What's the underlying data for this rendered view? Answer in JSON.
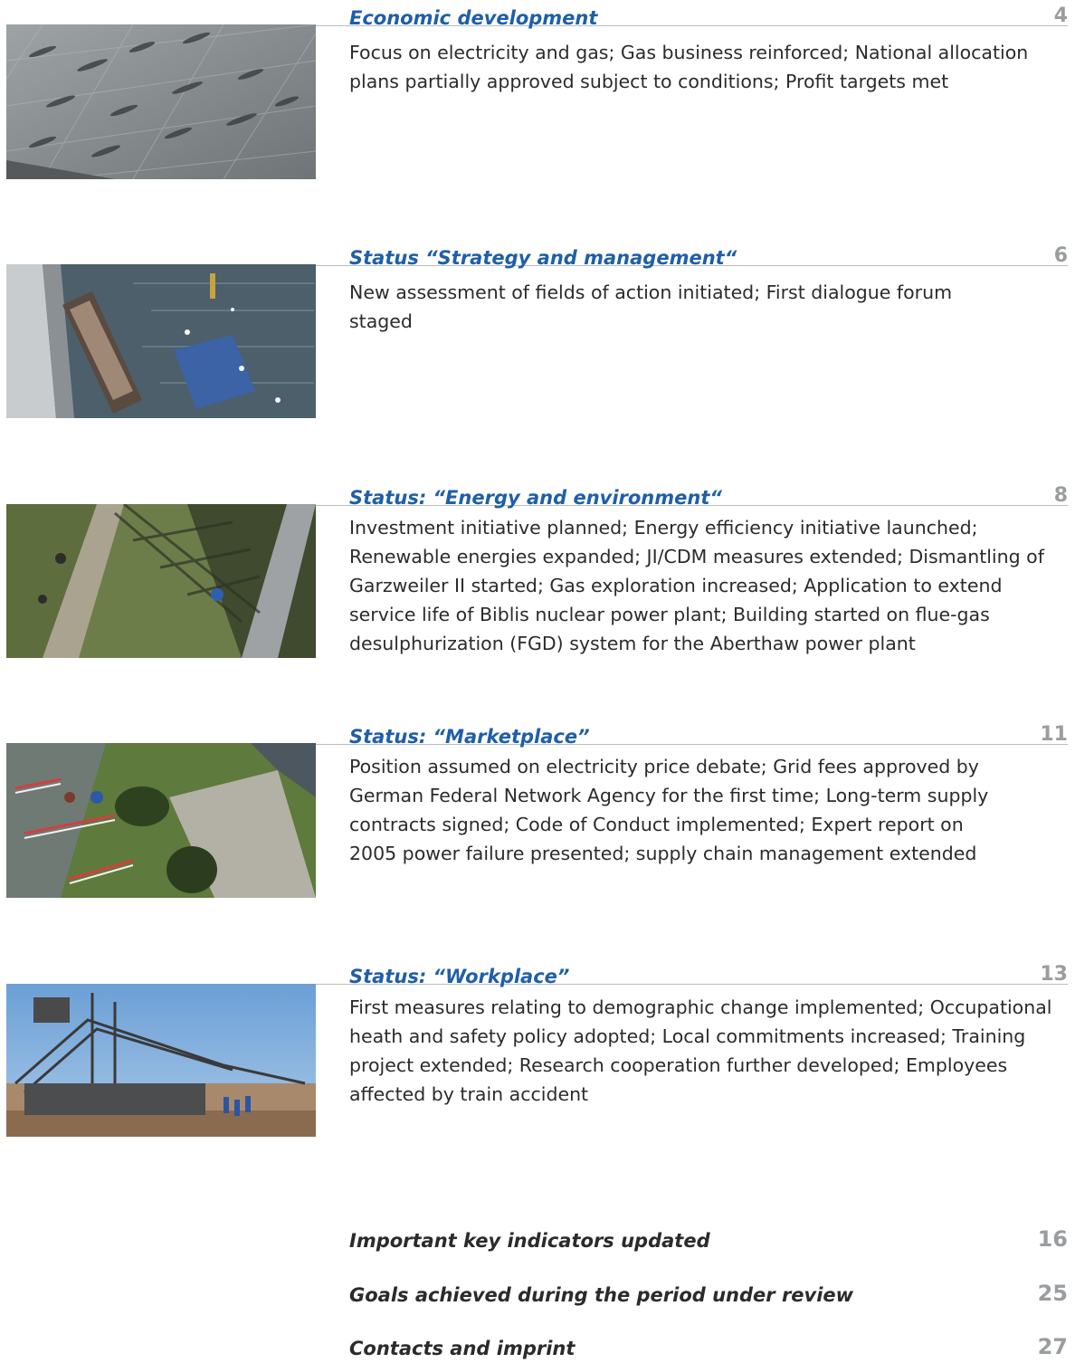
{
  "sections": [
    {
      "title": "Economic development",
      "page": "4",
      "description": "Focus on electricity and gas; Gas business reinforced; National allocation plans partially approved subject to conditions; Profit targets met",
      "photo": "aerial view of pedestrians casting long shadows on paved plaza"
    },
    {
      "title": "Status “Strategy and management“",
      "page": "6",
      "description": "New assessment of fields of action initiated; First dialogue forum staged",
      "photo": "aerial view of harbour with boat and floating container, gulls over water"
    },
    {
      "title": "Status: “Energy and environment“",
      "page": "8",
      "description": "Investment initiative planned; Energy efficiency initiative launched; Renewable energies expanded; JI/CDM measures extended; Dismantling of Garzweiler II started; Gas exploration increased; Application to extend service life of Biblis nuclear power plant; Building started on flue-gas desulphurization (FGD) system for the Aberthaw power plant",
      "photo": "aerial view of cyclists on path beside a lattice transmission tower"
    },
    {
      "title": "Status: “Marketplace”",
      "page": "11",
      "description": "Position assumed on electricity price debate; Grid fees approved by German Federal Network Agency for the first time; Long-term supply contracts signed; Code of Conduct implemented; Expert report on 2005 power failure presented; supply chain management extended",
      "photo": "aerial view of garden with barrier fences and workers near a house"
    },
    {
      "title": "Status: “Workplace”",
      "page": "13",
      "description": "First measures relating to demographic change implemented; Occupational heath and safety policy adopted; Local commitments increased; Training project extended; Research cooperation further developed; Employees affected by train accident",
      "photo": "bucket-wheel excavator in open-pit mine with workers in blue overalls"
    }
  ],
  "extras": [
    {
      "title": "Important key indicators updated",
      "page": "16"
    },
    {
      "title": "Goals achieved during the period under review",
      "page": "25"
    },
    {
      "title": "Contacts and imprint",
      "page": "27"
    }
  ],
  "colors": {
    "title_blue": "#1f5fa8",
    "page_grey": "#9a9d9f",
    "rule_grey": "#b9bcbe"
  }
}
